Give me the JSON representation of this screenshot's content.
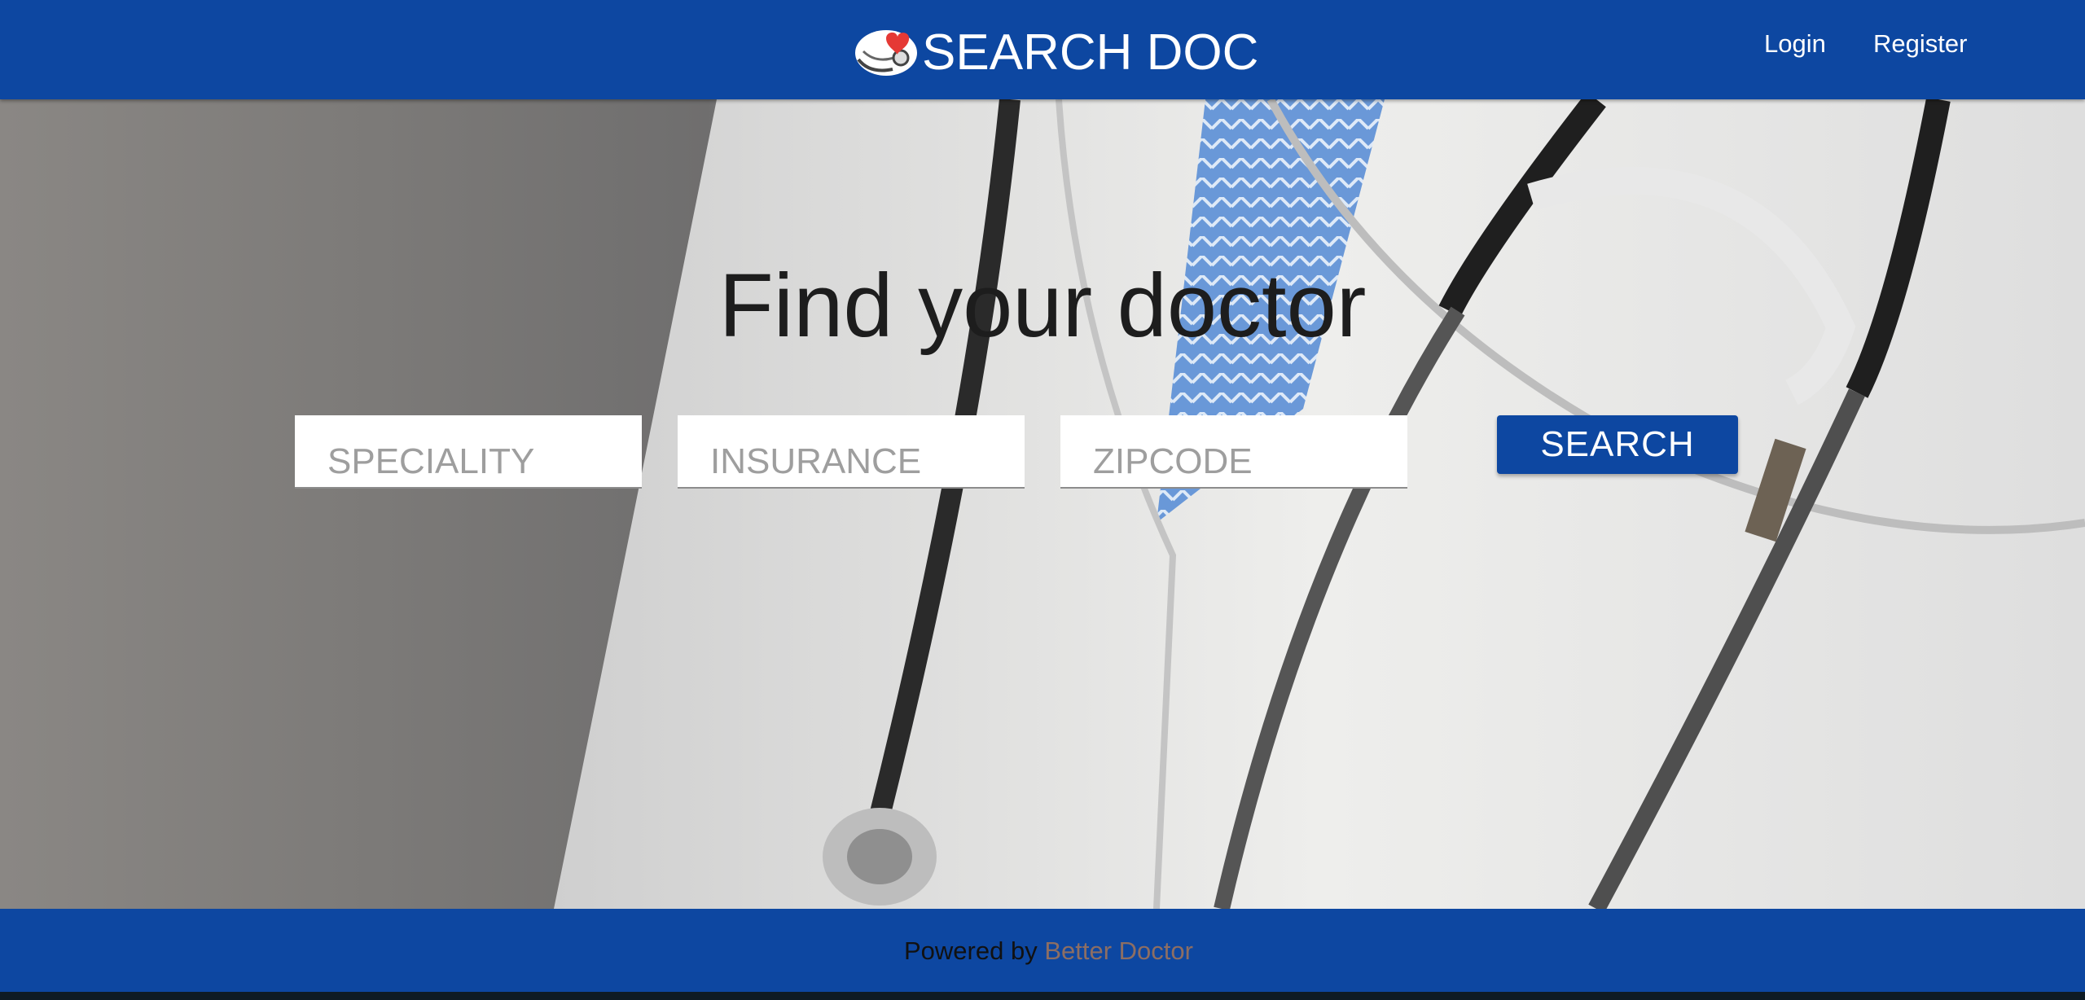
{
  "navbar": {
    "brand": "SEARCH DOC",
    "logo_icon": "doctor-heart-stethoscope-icon",
    "login": "Login",
    "register": "Register"
  },
  "hero": {
    "title": "Find your doctor",
    "background": "doctor-stethoscope-photo",
    "speciality_placeholder": "SPECIALITY",
    "insurance_placeholder": "INSURANCE",
    "zipcode_placeholder": "ZIPCODE",
    "search_label": "SEARCH"
  },
  "footer": {
    "prefix": "Powered by",
    "link": "Better Doctor"
  },
  "colors": {
    "primary": "#0d47a1",
    "footer_link": "#8d6e63"
  }
}
